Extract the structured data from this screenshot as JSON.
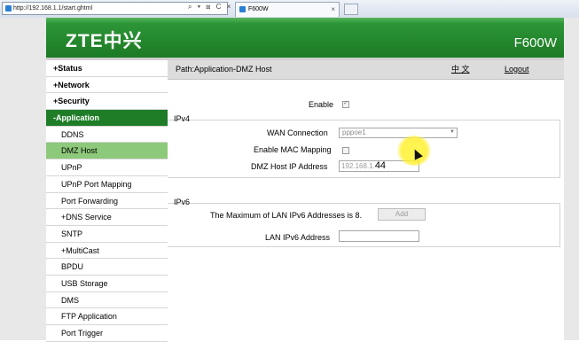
{
  "browser": {
    "address": "http://192.168.1.1/start.ghtml",
    "address_icons": "⌕ ▾ ⊠ C ×",
    "tab_title": "F600W",
    "tab_close": "×"
  },
  "header": {
    "logo": "ZTE中兴",
    "model": "F600W"
  },
  "sidebar": {
    "items": [
      {
        "label": "+Status",
        "type": "top"
      },
      {
        "label": "+Network",
        "type": "top"
      },
      {
        "label": "+Security",
        "type": "top"
      },
      {
        "label": "-Application",
        "type": "top",
        "active": true
      },
      {
        "label": "DDNS",
        "type": "sub"
      },
      {
        "label": "DMZ Host",
        "type": "sub",
        "active": true
      },
      {
        "label": "UPnP",
        "type": "sub"
      },
      {
        "label": "UPnP Port Mapping",
        "type": "sub"
      },
      {
        "label": "Port Forwarding",
        "type": "sub"
      },
      {
        "label": "+DNS Service",
        "type": "sub"
      },
      {
        "label": "SNTP",
        "type": "sub"
      },
      {
        "label": "+MultiCast",
        "type": "sub"
      },
      {
        "label": "BPDU",
        "type": "sub"
      },
      {
        "label": "USB Storage",
        "type": "sub"
      },
      {
        "label": "DMS",
        "type": "sub"
      },
      {
        "label": "FTP Application",
        "type": "sub"
      },
      {
        "label": "Port Trigger",
        "type": "sub"
      }
    ]
  },
  "pathbar": {
    "path": "Path:Application-DMZ Host",
    "language": "中 文",
    "logout": "Logout"
  },
  "form": {
    "enable_label": "Enable",
    "enable_checked": true,
    "ipv4_title": "IPv4",
    "wan_label": "WAN Connection",
    "wan_value": "pppoe1",
    "mac_label": "Enable MAC Mapping",
    "mac_checked": false,
    "dmz_ip_label": "DMZ Host IP Address",
    "dmz_ip_prefix": "192.168.1.",
    "dmz_ip_typed": "44",
    "ipv6_title": "IPv6",
    "ipv6_max_label": "The Maximum of LAN IPv6 Addresses is 8.",
    "add_label": "Add",
    "lan_ipv6_label": "LAN IPv6 Address",
    "lan_ipv6_value": ""
  },
  "colors": {
    "brand_green": "#1f7d28",
    "active_sub": "#8dc97a"
  }
}
